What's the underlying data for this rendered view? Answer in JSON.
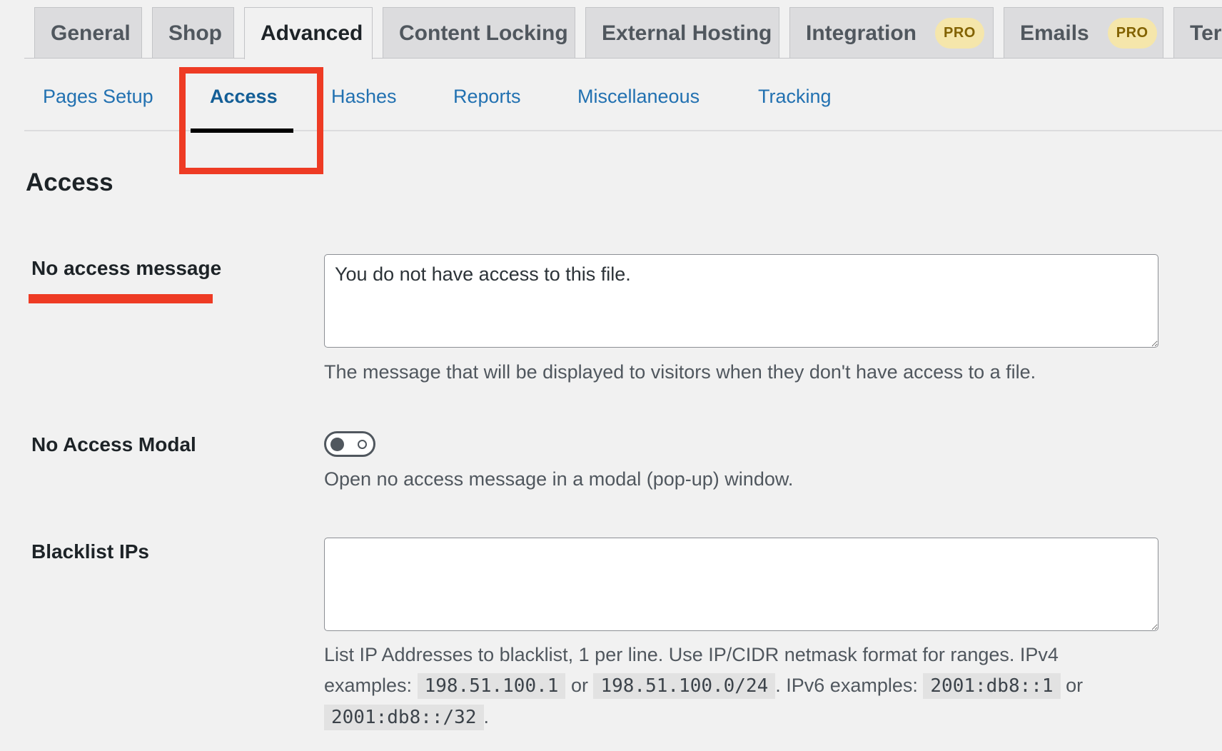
{
  "top_tabs": [
    {
      "label": "General"
    },
    {
      "label": "Shop"
    },
    {
      "label": "Advanced"
    },
    {
      "label": "Content Locking"
    },
    {
      "label": "External Hosting"
    },
    {
      "label": "Integration",
      "badge": "PRO"
    },
    {
      "label": "Emails",
      "badge": "PRO"
    },
    {
      "label": "Ter"
    }
  ],
  "sub_nav": [
    {
      "label": "Pages Setup"
    },
    {
      "label": "Access"
    },
    {
      "label": "Hashes"
    },
    {
      "label": "Reports"
    },
    {
      "label": "Miscellaneous"
    },
    {
      "label": "Tracking"
    }
  ],
  "section": {
    "title": "Access"
  },
  "fields": {
    "no_access_message": {
      "label": "No access message",
      "value": "You do not have access to this file.",
      "help": "The message that will be displayed to visitors when they don't have access to a file."
    },
    "no_access_modal": {
      "label": "No Access Modal",
      "checked": false,
      "help": "Open no access message in a modal (pop-up) window."
    },
    "blacklist_ips": {
      "label": "Blacklist IPs",
      "value": "",
      "help_1": "List IP Addresses to blacklist, 1 per line. Use IP/CIDR netmask format for ranges. IPv4",
      "help_2a": "examples:",
      "ipv4_a": "198.51.100.1",
      "or_1": "or",
      "ipv4_b": "198.51.100.0/24",
      "help_2b": ". IPv6 examples:",
      "ipv6_a": "2001:db8::1",
      "or_2": "or",
      "ipv6_b": "2001:db8::/32",
      "period": "."
    }
  },
  "colors": {
    "accent_link": "#2271b1",
    "annotation_red": "#ee3b24",
    "pro_badge_bg": "#f5e6ab"
  }
}
